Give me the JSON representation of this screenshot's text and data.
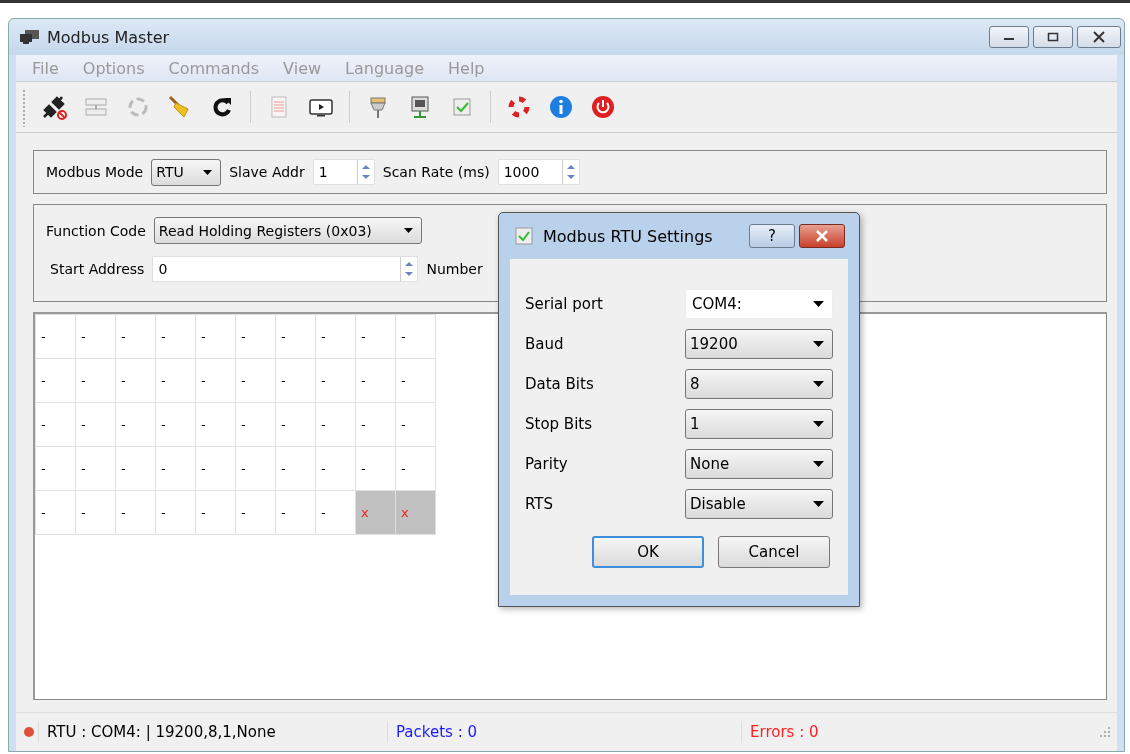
{
  "window": {
    "title": "Modbus Master"
  },
  "menu": [
    {
      "label": "File",
      "disabled": true
    },
    {
      "label": "Options",
      "disabled": true
    },
    {
      "label": "Commands",
      "disabled": true
    },
    {
      "label": "View",
      "disabled": true
    },
    {
      "label": "Language",
      "disabled": true
    },
    {
      "label": "Help",
      "disabled": true
    }
  ],
  "mode_bar": {
    "mode_label": "Modbus Mode",
    "mode": "RTU",
    "slave_label": "Slave Addr",
    "slave": "1",
    "scan_label": "Scan Rate (ms)",
    "scan": "1000"
  },
  "function_bar": {
    "function_label": "Function Code",
    "function": "Read Holding Registers (0x03)",
    "start_label": "Start Address",
    "start": "0",
    "number_label": "Number"
  },
  "grid": {
    "rows": [
      [
        {
          "text": "-",
          "kind": "value"
        },
        {
          "text": "-",
          "kind": "value"
        },
        {
          "text": "-",
          "kind": "value"
        },
        {
          "text": "-",
          "kind": "value"
        },
        {
          "text": "-",
          "kind": "value"
        },
        {
          "text": "-",
          "kind": "value"
        },
        {
          "text": "-",
          "kind": "value"
        },
        {
          "text": "-",
          "kind": "value"
        },
        {
          "text": "-",
          "kind": "value"
        },
        {
          "text": "-",
          "kind": "value"
        }
      ],
      [
        {
          "text": "-",
          "kind": "value"
        },
        {
          "text": "-",
          "kind": "value"
        },
        {
          "text": "-",
          "kind": "value"
        },
        {
          "text": "-",
          "kind": "value"
        },
        {
          "text": "-",
          "kind": "value"
        },
        {
          "text": "-",
          "kind": "value"
        },
        {
          "text": "-",
          "kind": "value"
        },
        {
          "text": "-",
          "kind": "value"
        },
        {
          "text": "-",
          "kind": "value"
        },
        {
          "text": "-",
          "kind": "value"
        }
      ],
      [
        {
          "text": "-",
          "kind": "value"
        },
        {
          "text": "-",
          "kind": "value"
        },
        {
          "text": "-",
          "kind": "value"
        },
        {
          "text": "-",
          "kind": "value"
        },
        {
          "text": "-",
          "kind": "value"
        },
        {
          "text": "-",
          "kind": "value"
        },
        {
          "text": "-",
          "kind": "value"
        },
        {
          "text": "-",
          "kind": "value"
        },
        {
          "text": "-",
          "kind": "value"
        },
        {
          "text": "-",
          "kind": "value"
        }
      ],
      [
        {
          "text": "-",
          "kind": "value"
        },
        {
          "text": "-",
          "kind": "value"
        },
        {
          "text": "-",
          "kind": "value"
        },
        {
          "text": "-",
          "kind": "value"
        },
        {
          "text": "-",
          "kind": "value"
        },
        {
          "text": "-",
          "kind": "value"
        },
        {
          "text": "-",
          "kind": "value"
        },
        {
          "text": "-",
          "kind": "value"
        },
        {
          "text": "-",
          "kind": "value"
        },
        {
          "text": "-",
          "kind": "value"
        }
      ],
      [
        {
          "text": "-",
          "kind": "value"
        },
        {
          "text": "-",
          "kind": "value"
        },
        {
          "text": "-",
          "kind": "value"
        },
        {
          "text": "-",
          "kind": "value"
        },
        {
          "text": "-",
          "kind": "value"
        },
        {
          "text": "-",
          "kind": "value"
        },
        {
          "text": "-",
          "kind": "value"
        },
        {
          "text": "-",
          "kind": "value"
        },
        {
          "text": "x",
          "kind": "invalid"
        },
        {
          "text": "x",
          "kind": "invalid"
        }
      ]
    ]
  },
  "dialog": {
    "title": "Modbus RTU Settings",
    "help": "?",
    "fields": [
      {
        "label": "Serial port",
        "value": "COM4:",
        "kind": "editable"
      },
      {
        "label": "Baud",
        "value": "19200",
        "kind": "select"
      },
      {
        "label": "Data Bits",
        "value": "8",
        "kind": "select"
      },
      {
        "label": "Stop Bits",
        "value": "1",
        "kind": "select"
      },
      {
        "label": "Parity",
        "value": "None",
        "kind": "select"
      },
      {
        "label": "RTS",
        "value": "Disable",
        "kind": "select"
      }
    ],
    "buttons": [
      {
        "label": "OK",
        "kind": "default"
      },
      {
        "label": "Cancel",
        "kind": "normal"
      }
    ]
  },
  "status_bar": {
    "fields": [
      {
        "text": "RTU : COM4: | 19200,8,1,None",
        "kind": "connection"
      },
      {
        "text": "Packets : 0",
        "kind": "packets"
      },
      {
        "text": "Errors : 0",
        "kind": "errors"
      }
    ]
  }
}
